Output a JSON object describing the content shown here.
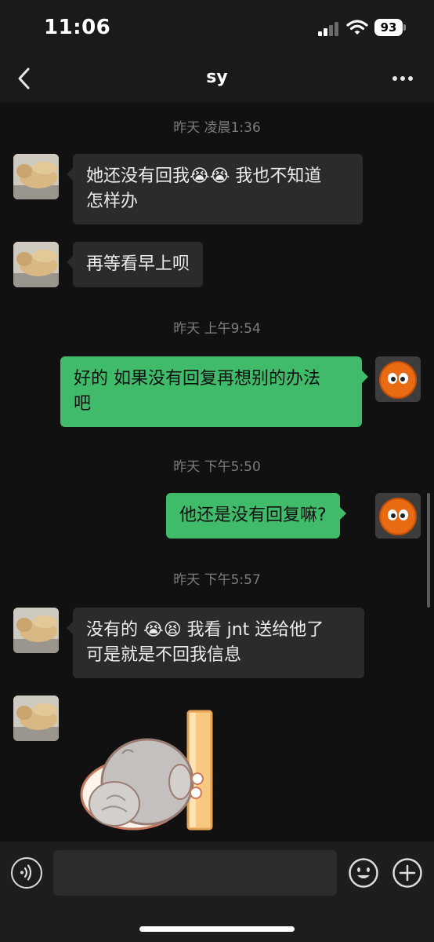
{
  "status_bar": {
    "time": "11:06",
    "battery": "93"
  },
  "header": {
    "title": "sy",
    "back_icon": "chevron-left-icon",
    "more_icon": "ellipsis-icon"
  },
  "chat": {
    "timestamps": [
      "昨天 凌晨1:36",
      "昨天 上午9:54",
      "昨天 下午5:50",
      "昨天 下午5:57"
    ],
    "messages": [
      {
        "sender": "contact",
        "line1": "她还没有回我😭😭 我也不知道",
        "line2": "怎样办"
      },
      {
        "sender": "contact",
        "line1": "再等看早上呗"
      },
      {
        "sender": "me",
        "line1": "好的 如果没有回复再想别的办法",
        "line2": "吧"
      },
      {
        "sender": "me",
        "line1": "他还是没有回复嘛?"
      },
      {
        "sender": "contact",
        "line1": "没有的 😭😫 我看 jnt 送给他了",
        "line2": "可是就是不回我信息"
      },
      {
        "sender": "contact",
        "type": "sticker",
        "sticker": "hamster-sticker"
      }
    ]
  },
  "input_bar": {
    "value": "",
    "voice_icon": "voice-icon",
    "emoji_icon": "emoji-icon",
    "plus_icon": "plus-icon"
  },
  "colors": {
    "outgoing_bubble": "#3fbb6a",
    "incoming_bubble": "#2b2b2b",
    "background": "#111111"
  }
}
